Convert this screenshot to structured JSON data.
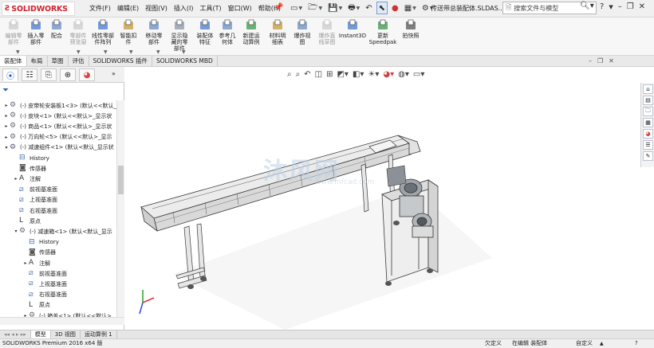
{
  "app": {
    "logo": "SOLIDWORKS",
    "menu": [
      "文件(F)",
      "编辑(E)",
      "视图(V)",
      "插入(I)",
      "工具(T)",
      "窗口(W)",
      "帮助(H)"
    ],
    "document_title": "传送带总装配体.SLDAS...",
    "search_placeholder": "搜索文件与模型",
    "help_label": "?"
  },
  "ribbon": {
    "buttons": [
      {
        "label": "编辑零\n部件",
        "enabled": false,
        "icon": "edit-component-icon"
      },
      {
        "label": "插入零\n部件",
        "enabled": true,
        "icon": "insert-component-icon"
      },
      {
        "label": "配合",
        "enabled": true,
        "icon": "mate-icon"
      },
      {
        "label": "零部件\n预览窗",
        "enabled": false,
        "icon": "component-preview-icon"
      },
      {
        "label": "线性零部\n件阵列",
        "enabled": true,
        "icon": "linear-pattern-icon"
      },
      {
        "label": "智能扣\n件",
        "enabled": true,
        "icon": "smart-fastener-icon"
      },
      {
        "label": "移动零\n部件",
        "enabled": true,
        "icon": "move-component-icon"
      },
      {
        "label": "显示隐\n藏的零\n部件",
        "enabled": true,
        "icon": "show-hidden-icon"
      },
      {
        "label": "装配体\n特征",
        "enabled": true,
        "icon": "assembly-feature-icon"
      },
      {
        "label": "参考几\n何体",
        "enabled": true,
        "icon": "reference-geometry-icon"
      },
      {
        "label": "新建运\n动算例",
        "enabled": true,
        "icon": "new-motion-study-icon"
      },
      {
        "label": "材料明\n细表",
        "enabled": true,
        "icon": "bom-icon"
      },
      {
        "label": "爆炸视\n图",
        "enabled": true,
        "icon": "exploded-view-icon"
      },
      {
        "label": "爆炸直\n线草图",
        "enabled": false,
        "icon": "explode-line-sketch-icon"
      },
      {
        "label": "Instant3D",
        "enabled": true,
        "icon": "instant3d-icon"
      },
      {
        "label": "更新\nSpeedpak",
        "enabled": true,
        "icon": "speedpak-icon"
      },
      {
        "label": "拍快照",
        "enabled": true,
        "icon": "snapshot-icon"
      }
    ]
  },
  "tabs": [
    "装配体",
    "布局",
    "草图",
    "评估",
    "SOLIDWORKS 插件",
    "SOLIDWORKS MBD"
  ],
  "active_tab": "装配体",
  "tree": [
    {
      "level": 0,
      "expander": "▸",
      "icon": "component-icon",
      "label": "(-) 皮带轮安装板1<3> (默认<<默认_"
    },
    {
      "level": 0,
      "expander": "▸",
      "icon": "component-icon",
      "label": "(-) 皮块<1> (默认<<默认>_显示状"
    },
    {
      "level": 0,
      "expander": "▸",
      "icon": "component-icon",
      "label": "(-) 商品<1> (默认<<默认>_显示状"
    },
    {
      "level": 0,
      "expander": "▸",
      "icon": "component-icon",
      "label": "(-) 万向轮<5> (默认<<默认>_显示"
    },
    {
      "level": 0,
      "expander": "▾",
      "icon": "subassembly-icon",
      "label": "(-) 减速组件<1> (默认<默认_显示状"
    },
    {
      "level": 1,
      "expander": "",
      "icon": "history-icon",
      "label": "History"
    },
    {
      "level": 1,
      "expander": "",
      "icon": "sensor-icon",
      "label": "传感器"
    },
    {
      "level": 1,
      "expander": "▸",
      "icon": "annotation-icon",
      "label": "注解"
    },
    {
      "level": 1,
      "expander": "",
      "icon": "plane-icon",
      "label": "前视基准面"
    },
    {
      "level": 1,
      "expander": "",
      "icon": "plane-icon",
      "label": "上视基准面"
    },
    {
      "level": 1,
      "expander": "",
      "icon": "plane-icon",
      "label": "右视基准面"
    },
    {
      "level": 1,
      "expander": "",
      "icon": "origin-icon",
      "label": "原点"
    },
    {
      "level": 1,
      "expander": "▾",
      "icon": "component-icon",
      "label": "(-) 减速箱<1> (默认<默认_显示"
    },
    {
      "level": 2,
      "expander": "",
      "icon": "history-icon",
      "label": "History"
    },
    {
      "level": 2,
      "expander": "",
      "icon": "sensor-icon",
      "label": "传感器"
    },
    {
      "level": 2,
      "expander": "▸",
      "icon": "annotation-icon",
      "label": "注解"
    },
    {
      "level": 2,
      "expander": "",
      "icon": "plane-icon",
      "label": "前视基准面"
    },
    {
      "level": 2,
      "expander": "",
      "icon": "plane-icon",
      "label": "上视基准面"
    },
    {
      "level": 2,
      "expander": "",
      "icon": "plane-icon",
      "label": "右视基准面"
    },
    {
      "level": 2,
      "expander": "",
      "icon": "origin-icon",
      "label": "原点"
    },
    {
      "level": 2,
      "expander": "▸",
      "icon": "component-icon",
      "label": "(-) 箱盖<1> (默认<<默认>_"
    }
  ],
  "bottom_tabs": [
    "模型",
    "3D 视图",
    "运动算例 1"
  ],
  "active_bottom_tab": "模型",
  "status": {
    "product": "SOLIDWORKS Premium 2016 x64 版",
    "underdefined": "欠定义",
    "editing": "在编辑 装配体",
    "custom": "自定义"
  },
  "watermark": {
    "main": "沐风网",
    "sub": "www.mfcad.com"
  },
  "colors": {
    "brand": "#d3202d",
    "accent": "#2a63b8",
    "model_fill": "#e8e8e8",
    "model_line": "#3a3a3a"
  }
}
